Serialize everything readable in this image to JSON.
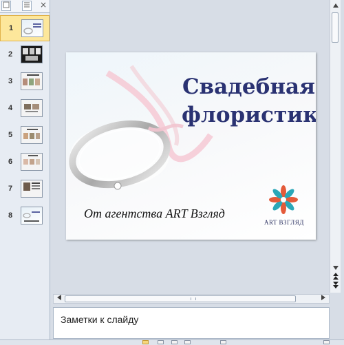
{
  "panel": {
    "tab_close_icon": "×",
    "thumbnails": [
      {
        "num": "1"
      },
      {
        "num": "2"
      },
      {
        "num": "3"
      },
      {
        "num": "4"
      },
      {
        "num": "5"
      },
      {
        "num": "6"
      },
      {
        "num": "7"
      },
      {
        "num": "8"
      }
    ]
  },
  "slide": {
    "title_line1": "Свадебная",
    "title_line2": "флористика",
    "subtitle": "От агентства ART Взгляд",
    "logo_text": "ART ВЗГЛЯД"
  },
  "notes": {
    "placeholder": "Заметки к слайду"
  },
  "colors": {
    "title": "#2a3272",
    "selection": "#fde79b",
    "app_background": "#d7dde6"
  },
  "icons": {
    "scroll_up": "up-arrow-icon",
    "scroll_down": "down-arrow-icon",
    "scroll_left": "left-arrow-icon",
    "scroll_right": "right-arrow-icon"
  }
}
